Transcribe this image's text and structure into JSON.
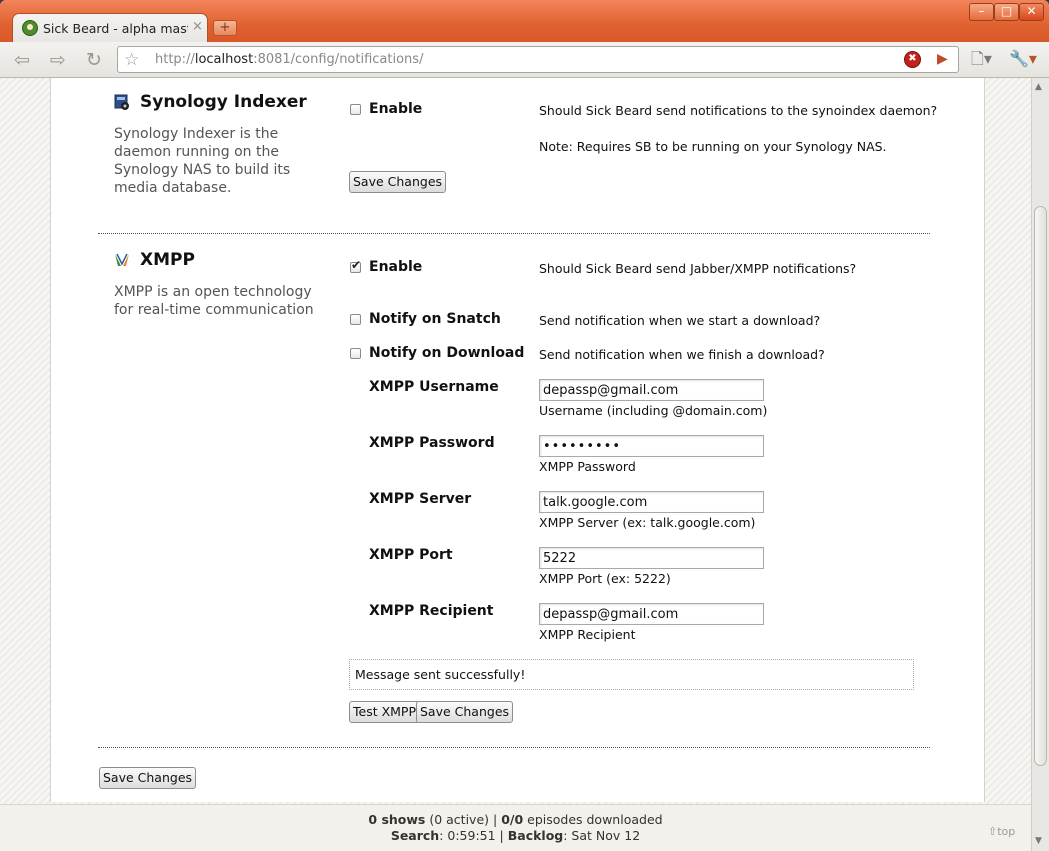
{
  "browser": {
    "tab_title": "Sick Beard - alpha mast…",
    "tab_close": "×",
    "new_tab": "+",
    "url_prefix": "http://",
    "url_host": "localhost",
    "url_rest": ":8081/config/notifications/",
    "controls": {
      "minimize": "–",
      "maximize": "□",
      "close": "✕"
    }
  },
  "synology": {
    "title": "Synology Indexer",
    "description": "Synology Indexer is the daemon running on the Synology NAS to build its media database.",
    "enable_label": "Enable",
    "enable_checked": false,
    "enable_help": "Should Sick Beard send notifications to the synoindex daemon?",
    "note": "Note: Requires SB to be running on your Synology NAS.",
    "save_label": "Save Changes"
  },
  "xmpp": {
    "title": "XMPP",
    "description": "XMPP is an open technology for real-time communication",
    "enable_label": "Enable",
    "enable_checked": true,
    "enable_help": "Should Sick Beard send Jabber/XMPP notifications?",
    "snatch_label": "Notify on Snatch",
    "snatch_help": "Send notification when we start a download?",
    "download_label": "Notify on Download",
    "download_help": "Send notification when we finish a download?",
    "fields": {
      "username": {
        "label": "XMPP Username",
        "value": "depassp@gmail.com",
        "help": "Username (including @domain.com)"
      },
      "password": {
        "label": "XMPP Password",
        "value": "•••••••••",
        "help": "XMPP Password"
      },
      "server": {
        "label": "XMPP Server",
        "value": "talk.google.com",
        "help": "XMPP Server (ex: talk.google.com)"
      },
      "port": {
        "label": "XMPP Port",
        "value": "5222",
        "help": "XMPP Port (ex: 5222)"
      },
      "recipient": {
        "label": "XMPP Recipient",
        "value": "depassp@gmail.com",
        "help": "XMPP Recipient"
      }
    },
    "message": "Message sent successfully!",
    "test_label": "Test XMPP",
    "save_label": "Save Changes"
  },
  "page": {
    "save_all_label": "Save Changes"
  },
  "footer": {
    "shows_count": "0 shows",
    "shows_active": " (0 active) | ",
    "episodes_count": "0/0",
    "episodes_text": " episodes downloaded",
    "search_label": "Search",
    "search_value": ": 0:59:51 | ",
    "backlog_label": "Backlog",
    "backlog_value": ": Sat Nov 12",
    "top_link": "top"
  },
  "colors": {
    "titlebar": "#e0612f",
    "accent": "#d9582a"
  }
}
